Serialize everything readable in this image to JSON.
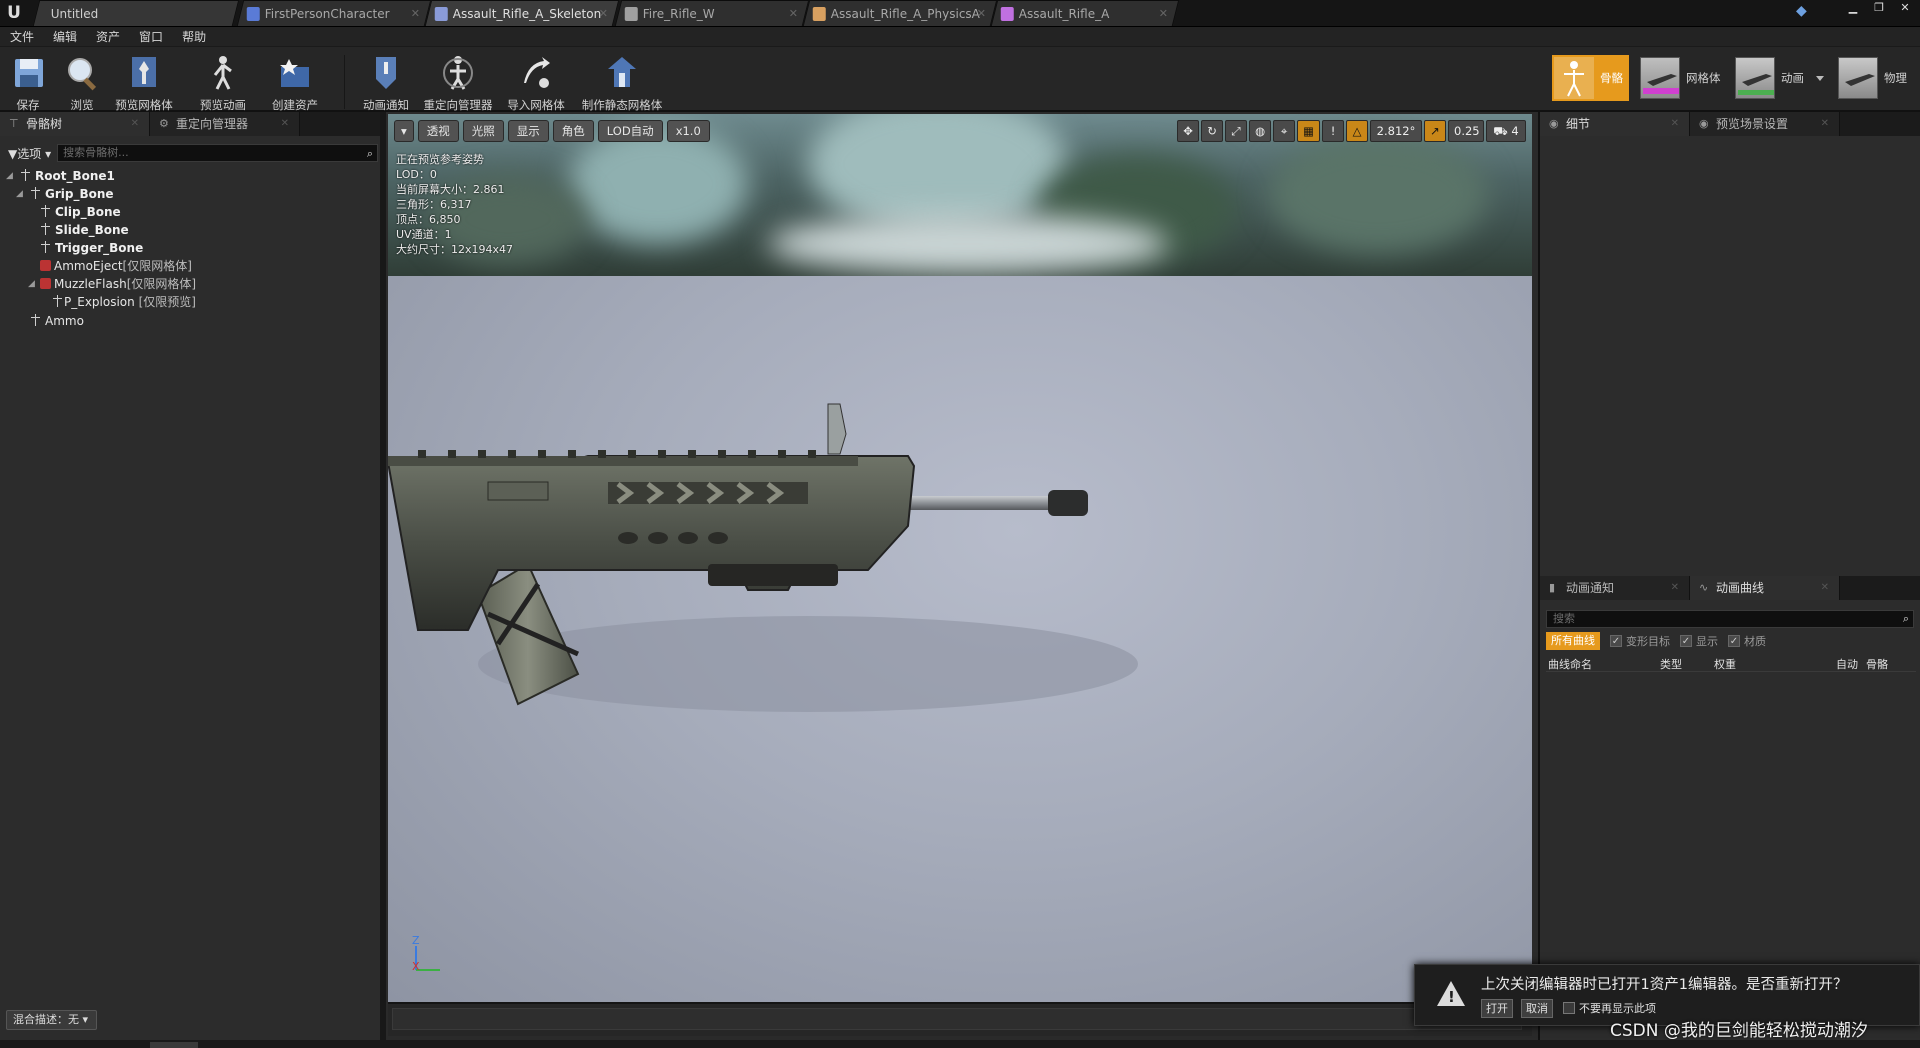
{
  "title_tabs": [
    {
      "label": "Untitled",
      "icon": "ue-logo-icon"
    },
    {
      "label": "FirstPersonCharacter",
      "icon": "blueprint-icon",
      "color": "#5a7bd6"
    },
    {
      "label": "Assault_Rifle_A_Skeleton",
      "icon": "skeleton-icon",
      "color": "#8a9bd8"
    },
    {
      "label": "Fire_Rifle_W",
      "icon": "montage-icon",
      "color": "#a0a0a0"
    },
    {
      "label": "Assault_Rifle_A_PhysicsA",
      "icon": "physics-asset-icon",
      "color": "#d8a060"
    },
    {
      "label": "Assault_Rifle_A",
      "icon": "skeletal-mesh-icon",
      "color": "#c070e0"
    }
  ],
  "menu": [
    "文件",
    "编辑",
    "资产",
    "窗口",
    "帮助"
  ],
  "toolbar": {
    "buttons": [
      "保存",
      "浏览",
      "预览网格体",
      "预览动画",
      "创建资产",
      "动画通知",
      "重定向管理器",
      "导入网格体",
      "制作静态网格体"
    ]
  },
  "modes": [
    "骨骼",
    "网格体",
    "动画",
    "物理"
  ],
  "left_panel": {
    "tabs": [
      "骨骼树",
      "重定向管理器"
    ],
    "options_label": "选项",
    "search_placeholder": "搜索骨骼树...",
    "tree": [
      {
        "label": "Root_Bone1",
        "bold": true,
        "type": "bone",
        "expander": true
      },
      {
        "label": "Grip_Bone",
        "bold": true,
        "type": "bone",
        "expander": true
      },
      {
        "label": "Clip_Bone",
        "bold": true,
        "type": "bone"
      },
      {
        "label": "Slide_Bone",
        "bold": true,
        "type": "bone"
      },
      {
        "label": "Trigger_Bone",
        "bold": true,
        "type": "bone"
      },
      {
        "label": "AmmoEject",
        "tag": "[仅限网格体]",
        "type": "socket"
      },
      {
        "label": "MuzzleFlash",
        "tag": "[仅限网格体]",
        "type": "socket",
        "expander": true
      },
      {
        "label": "P_Explosion",
        "tag": " [仅限预览]",
        "type": "preview"
      },
      {
        "label": "Ammo",
        "type": "bone"
      }
    ],
    "blend_desc": "混合描述：无"
  },
  "viewport": {
    "buttons": [
      "透视",
      "光照",
      "显示",
      "角色",
      "LOD自动",
      "x1.0"
    ],
    "right_values": [
      "2.812°",
      "0.25",
      "4"
    ],
    "stats": [
      "正在预览参考姿势",
      "LOD：0",
      "当前屏幕大小：2.861",
      "三角形：6,317",
      "顶点：6,850",
      "UV通道：1",
      "大约尺寸：12x194x47"
    ],
    "axis_labels": [
      "Z",
      "X"
    ]
  },
  "right_panel": {
    "tabs": [
      "细节",
      "预览场景设置"
    ],
    "anim_tabs": [
      "动画通知",
      "动画曲线"
    ],
    "search_placeholder": "搜索",
    "filters": {
      "all": "所有曲线",
      "checks": [
        "变形目标",
        "显示",
        "材质"
      ]
    },
    "columns": [
      "曲线命名",
      "类型",
      "权重",
      "自动",
      "骨骼"
    ]
  },
  "notification": {
    "message": "上次关闭编辑器时已打开1资产1编辑器。是否重新打开？",
    "open": "打开",
    "cancel": "取消",
    "dont_show": "不要再显示此项"
  },
  "watermark": "CSDN @我的巨剑能轻松搅动潮汐",
  "colors": {
    "accent": "#e69a1d",
    "panel": "#2c2c2c",
    "titlebar": "#151515"
  }
}
